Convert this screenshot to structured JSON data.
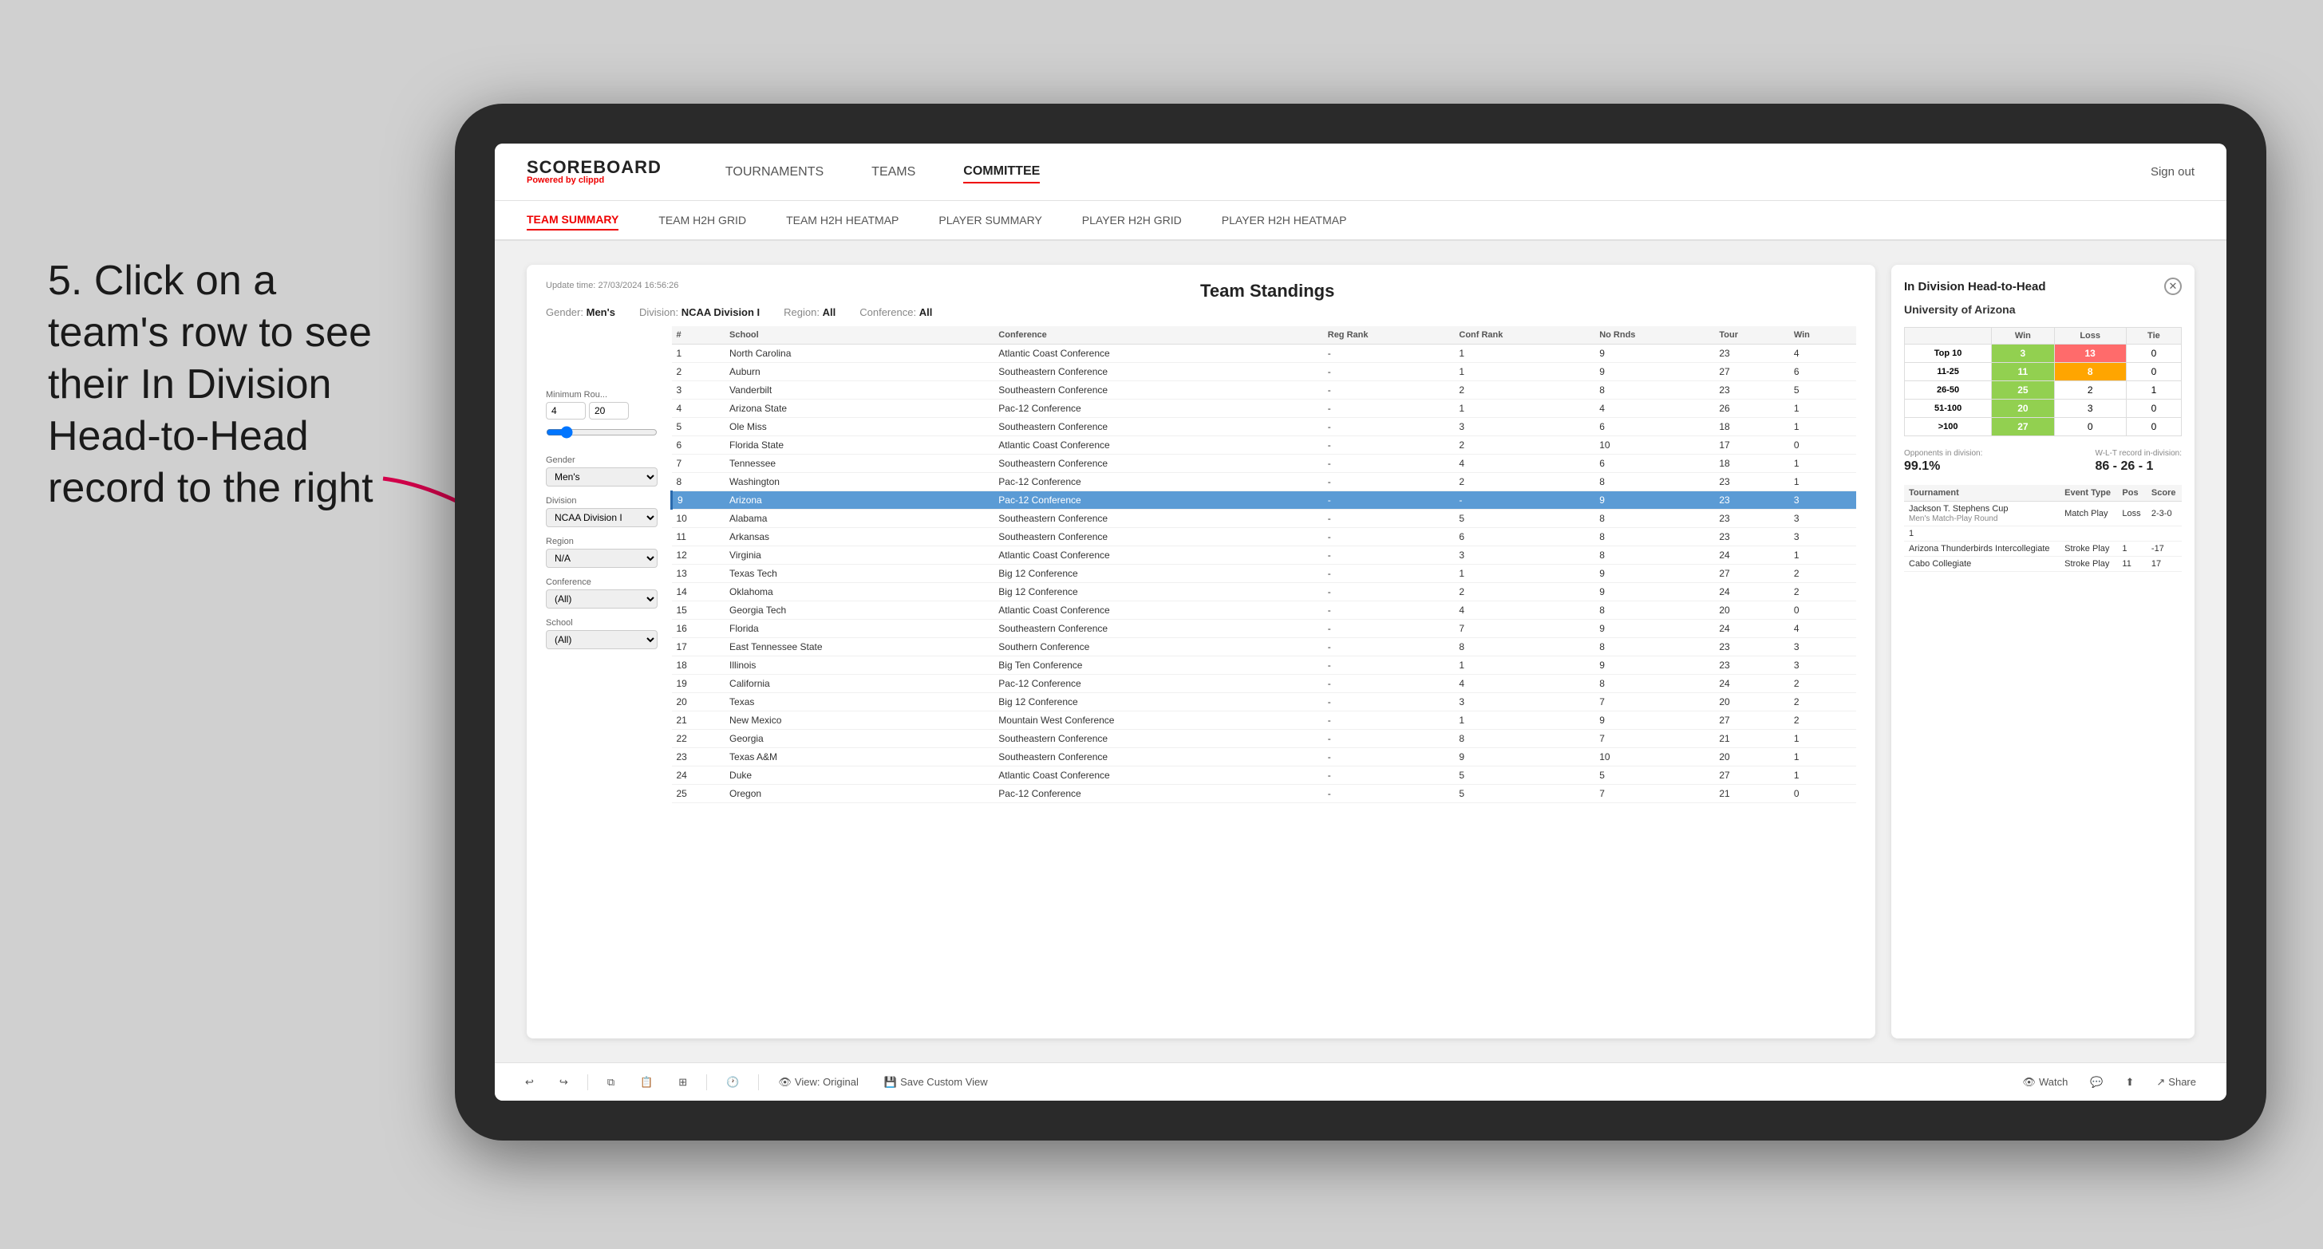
{
  "annotation": {
    "text": "5. Click on a team's row to see their In Division Head-to-Head record to the right"
  },
  "nav": {
    "logo": "SCOREBOARD",
    "logo_sub": "Powered by",
    "logo_brand": "clippd",
    "links": [
      "TOURNAMENTS",
      "TEAMS",
      "COMMITTEE"
    ],
    "active_link": "COMMITTEE",
    "sign_out": "Sign out"
  },
  "subnav": {
    "links": [
      "TEAM SUMMARY",
      "TEAM H2H GRID",
      "TEAM H2H HEATMAP",
      "PLAYER SUMMARY",
      "PLAYER H2H GRID",
      "PLAYER H2H HEATMAP"
    ],
    "active_link": "TEAM SUMMARY"
  },
  "content": {
    "update_time_label": "Update time:",
    "update_time": "27/03/2024 16:56:26",
    "title": "Team Standings",
    "filters": {
      "gender_label": "Gender:",
      "gender_value": "Men's",
      "division_label": "Division:",
      "division_value": "NCAA Division I",
      "region_label": "Region:",
      "region_value": "All",
      "conference_label": "Conference:",
      "conference_value": "All"
    },
    "sidebar": {
      "min_rounds_label": "Minimum Rou...",
      "min_rounds_val1": "4",
      "min_rounds_val2": "20",
      "gender_label": "Gender",
      "gender_value": "Men's",
      "division_label": "Division",
      "division_value": "NCAA Division I",
      "region_label": "Region",
      "region_value": "N/A",
      "conference_label": "Conference",
      "conference_value": "(All)",
      "school_label": "School",
      "school_value": "(All)"
    },
    "table": {
      "columns": [
        "#",
        "School",
        "Conference",
        "Reg Rank",
        "Conf Rank",
        "No Rnds",
        "Tour",
        "Win"
      ],
      "rows": [
        {
          "rank": "1",
          "school": "North Carolina",
          "conference": "Atlantic Coast Conference",
          "reg_rank": "-",
          "conf_rank": "1",
          "no_rnds": "9",
          "tour": "23",
          "win": "4"
        },
        {
          "rank": "2",
          "school": "Auburn",
          "conference": "Southeastern Conference",
          "reg_rank": "-",
          "conf_rank": "1",
          "no_rnds": "9",
          "tour": "27",
          "win": "6"
        },
        {
          "rank": "3",
          "school": "Vanderbilt",
          "conference": "Southeastern Conference",
          "reg_rank": "-",
          "conf_rank": "2",
          "no_rnds": "8",
          "tour": "23",
          "win": "5"
        },
        {
          "rank": "4",
          "school": "Arizona State",
          "conference": "Pac-12 Conference",
          "reg_rank": "-",
          "conf_rank": "1",
          "no_rnds": "4",
          "tour": "26",
          "win": "1"
        },
        {
          "rank": "5",
          "school": "Ole Miss",
          "conference": "Southeastern Conference",
          "reg_rank": "-",
          "conf_rank": "3",
          "no_rnds": "6",
          "tour": "18",
          "win": "1"
        },
        {
          "rank": "6",
          "school": "Florida State",
          "conference": "Atlantic Coast Conference",
          "reg_rank": "-",
          "conf_rank": "2",
          "no_rnds": "10",
          "tour": "17",
          "win": "0"
        },
        {
          "rank": "7",
          "school": "Tennessee",
          "conference": "Southeastern Conference",
          "reg_rank": "-",
          "conf_rank": "4",
          "no_rnds": "6",
          "tour": "18",
          "win": "1"
        },
        {
          "rank": "8",
          "school": "Washington",
          "conference": "Pac-12 Conference",
          "reg_rank": "-",
          "conf_rank": "2",
          "no_rnds": "8",
          "tour": "23",
          "win": "1"
        },
        {
          "rank": "9",
          "school": "Arizona",
          "conference": "Pac-12 Conference",
          "reg_rank": "-",
          "conf_rank": "-",
          "no_rnds": "9",
          "tour": "23",
          "win": "3",
          "highlighted": true
        },
        {
          "rank": "10",
          "school": "Alabama",
          "conference": "Southeastern Conference",
          "reg_rank": "-",
          "conf_rank": "5",
          "no_rnds": "8",
          "tour": "23",
          "win": "3"
        },
        {
          "rank": "11",
          "school": "Arkansas",
          "conference": "Southeastern Conference",
          "reg_rank": "-",
          "conf_rank": "6",
          "no_rnds": "8",
          "tour": "23",
          "win": "3"
        },
        {
          "rank": "12",
          "school": "Virginia",
          "conference": "Atlantic Coast Conference",
          "reg_rank": "-",
          "conf_rank": "3",
          "no_rnds": "8",
          "tour": "24",
          "win": "1"
        },
        {
          "rank": "13",
          "school": "Texas Tech",
          "conference": "Big 12 Conference",
          "reg_rank": "-",
          "conf_rank": "1",
          "no_rnds": "9",
          "tour": "27",
          "win": "2"
        },
        {
          "rank": "14",
          "school": "Oklahoma",
          "conference": "Big 12 Conference",
          "reg_rank": "-",
          "conf_rank": "2",
          "no_rnds": "9",
          "tour": "24",
          "win": "2"
        },
        {
          "rank": "15",
          "school": "Georgia Tech",
          "conference": "Atlantic Coast Conference",
          "reg_rank": "-",
          "conf_rank": "4",
          "no_rnds": "8",
          "tour": "20",
          "win": "0"
        },
        {
          "rank": "16",
          "school": "Florida",
          "conference": "Southeastern Conference",
          "reg_rank": "-",
          "conf_rank": "7",
          "no_rnds": "9",
          "tour": "24",
          "win": "4"
        },
        {
          "rank": "17",
          "school": "East Tennessee State",
          "conference": "Southern Conference",
          "reg_rank": "-",
          "conf_rank": "8",
          "no_rnds": "8",
          "tour": "23",
          "win": "3"
        },
        {
          "rank": "18",
          "school": "Illinois",
          "conference": "Big Ten Conference",
          "reg_rank": "-",
          "conf_rank": "1",
          "no_rnds": "9",
          "tour": "23",
          "win": "3"
        },
        {
          "rank": "19",
          "school": "California",
          "conference": "Pac-12 Conference",
          "reg_rank": "-",
          "conf_rank": "4",
          "no_rnds": "8",
          "tour": "24",
          "win": "2"
        },
        {
          "rank": "20",
          "school": "Texas",
          "conference": "Big 12 Conference",
          "reg_rank": "-",
          "conf_rank": "3",
          "no_rnds": "7",
          "tour": "20",
          "win": "2"
        },
        {
          "rank": "21",
          "school": "New Mexico",
          "conference": "Mountain West Conference",
          "reg_rank": "-",
          "conf_rank": "1",
          "no_rnds": "9",
          "tour": "27",
          "win": "2"
        },
        {
          "rank": "22",
          "school": "Georgia",
          "conference": "Southeastern Conference",
          "reg_rank": "-",
          "conf_rank": "8",
          "no_rnds": "7",
          "tour": "21",
          "win": "1"
        },
        {
          "rank": "23",
          "school": "Texas A&M",
          "conference": "Southeastern Conference",
          "reg_rank": "-",
          "conf_rank": "9",
          "no_rnds": "10",
          "tour": "20",
          "win": "1"
        },
        {
          "rank": "24",
          "school": "Duke",
          "conference": "Atlantic Coast Conference",
          "reg_rank": "-",
          "conf_rank": "5",
          "no_rnds": "5",
          "tour": "27",
          "win": "1"
        },
        {
          "rank": "25",
          "school": "Oregon",
          "conference": "Pac-12 Conference",
          "reg_rank": "-",
          "conf_rank": "5",
          "no_rnds": "7",
          "tour": "21",
          "win": "0"
        }
      ]
    }
  },
  "h2h": {
    "title": "In Division Head-to-Head",
    "school": "University of Arizona",
    "table_headers": [
      "",
      "Win",
      "Loss",
      "Tie"
    ],
    "rows": [
      {
        "label": "Top 10",
        "win": "3",
        "loss": "13",
        "tie": "0",
        "win_color": "green",
        "loss_color": "red",
        "tie_color": "white"
      },
      {
        "label": "11-25",
        "win": "11",
        "loss": "8",
        "tie": "0",
        "win_color": "green",
        "loss_color": "orange",
        "tie_color": "white"
      },
      {
        "label": "26-50",
        "win": "25",
        "loss": "2",
        "tie": "1",
        "win_color": "green",
        "loss_color": "white",
        "tie_color": "white"
      },
      {
        "label": "51-100",
        "win": "20",
        "loss": "3",
        "tie": "0",
        "win_color": "green",
        "loss_color": "white",
        "tie_color": "white"
      },
      {
        "label": ">100",
        "win": "27",
        "loss": "0",
        "tie": "0",
        "win_color": "green",
        "loss_color": "white",
        "tie_color": "white"
      }
    ],
    "opponents_label": "Opponents in division:",
    "opponents_value": "99.1%",
    "record_label": "W-L-T record in-division:",
    "record_value": "86 - 26 - 1",
    "tournament_columns": [
      "Tournament",
      "Event Type",
      "Pos",
      "Score"
    ],
    "tournaments": [
      {
        "name": "Jackson T. Stephens Cup",
        "sub": "Men's Match-Play Round",
        "event_type": "Match Play",
        "pos": "Loss",
        "score": "2-3-0"
      },
      {
        "name": "1",
        "sub": "",
        "event_type": "",
        "pos": "",
        "score": ""
      },
      {
        "name": "Arizona Thunderbirds Intercollegiate",
        "sub": "",
        "event_type": "Stroke Play",
        "pos": "1",
        "score": "-17"
      },
      {
        "name": "Cabo Collegiate",
        "sub": "",
        "event_type": "Stroke Play",
        "pos": "11",
        "score": "17"
      }
    ]
  },
  "toolbar": {
    "view_original": "View: Original",
    "save_custom": "Save Custom View",
    "watch": "Watch",
    "share": "Share"
  }
}
